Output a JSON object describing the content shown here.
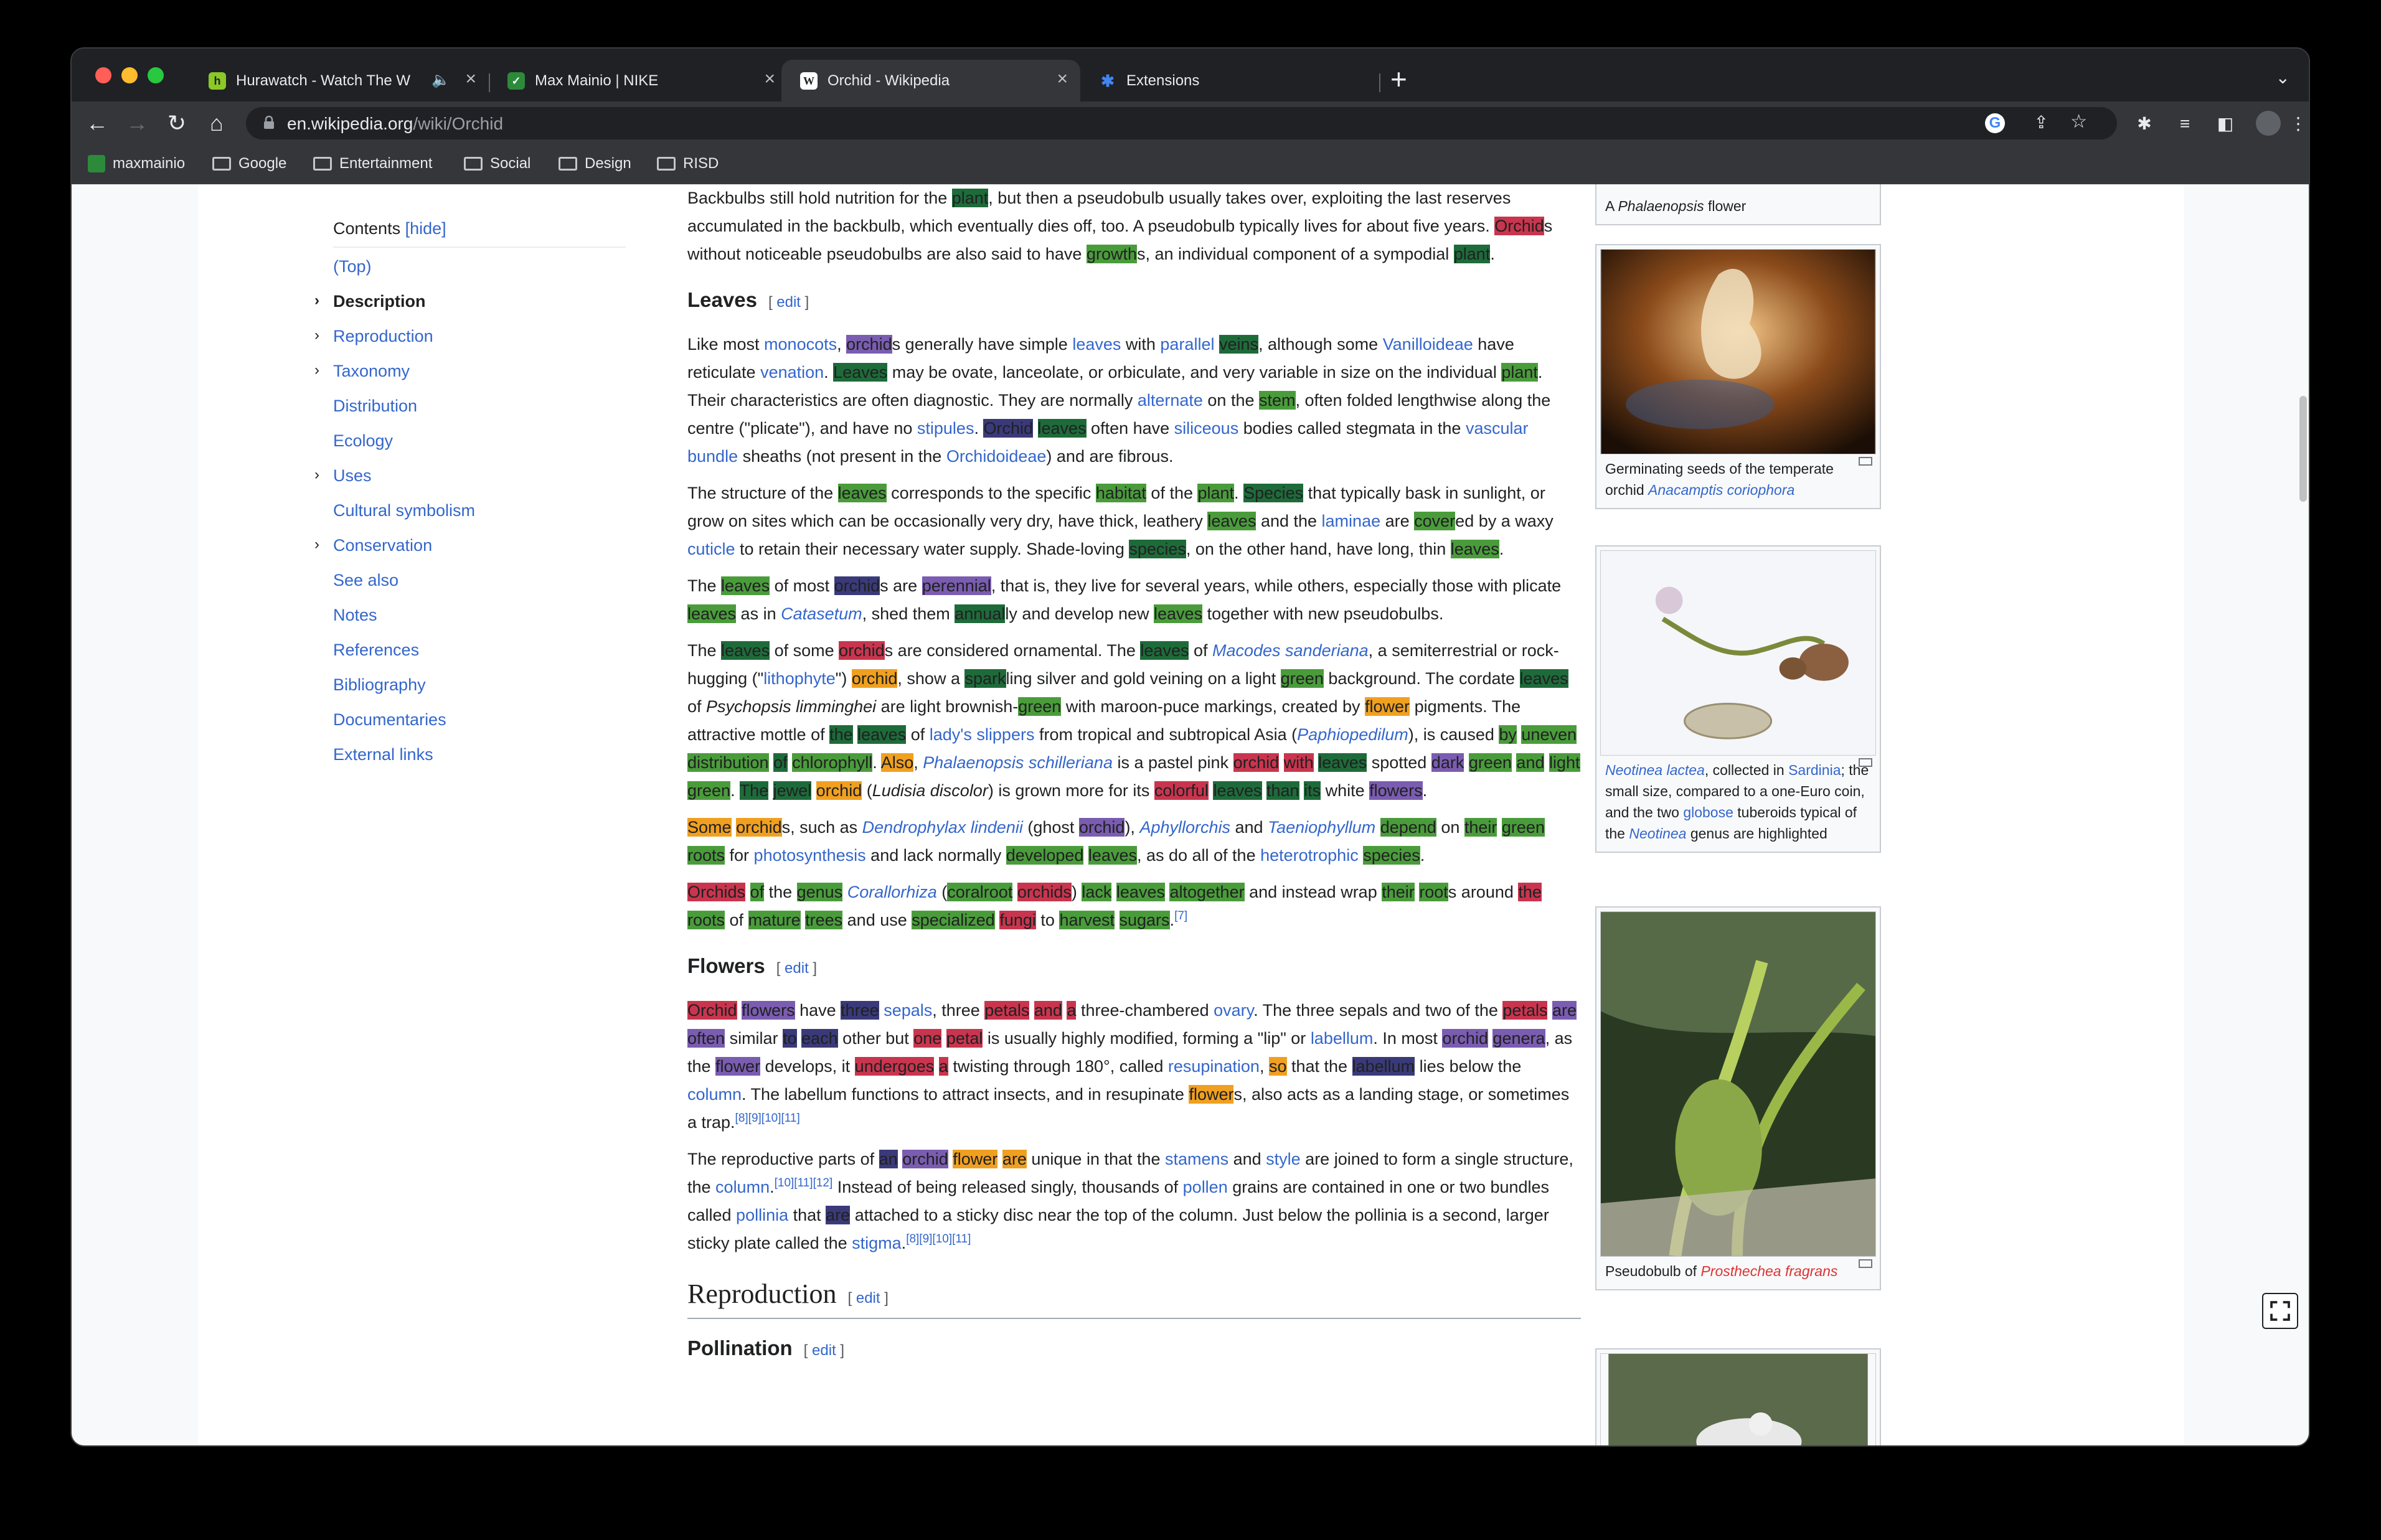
{
  "browser": {
    "tabs": [
      {
        "title": "Hurawatch - Watch The W",
        "icon": "hurawatch-icon",
        "audio": true
      },
      {
        "title": "Max Mainio | NIKE",
        "icon": "nike-icon"
      },
      {
        "title": "Orchid - Wikipedia",
        "icon": "wikipedia-icon",
        "active": true
      },
      {
        "title": "Extensions",
        "icon": "puzzle-icon"
      }
    ],
    "url_domain": "en.wikipedia.org",
    "url_path": "/wiki/Orchid",
    "bookmarks": [
      "maxmainio",
      "Google",
      "Entertainment",
      "Social",
      "Design",
      "RISD"
    ]
  },
  "toc": {
    "title": "Contents",
    "hide": "[hide]",
    "items": [
      "(Top)",
      "Description",
      "Reproduction",
      "Taxonomy",
      "Distribution",
      "Ecology",
      "Uses",
      "Cultural symbolism",
      "Conservation",
      "See also",
      "Notes",
      "References",
      "Bibliography",
      "Documentaries",
      "External links"
    ]
  },
  "article": {
    "leaves_heading": "Leaves",
    "flowers_heading": "Flowers",
    "reproduction_heading": "Reproduction",
    "pollination_heading": "Pollination",
    "edit": "edit"
  },
  "thumbs": {
    "t1": "A Phalaenopsis flower",
    "t2": "Germinating seeds of the temperate orchid Anacamptis coriophora",
    "t3": "Neotinea lactea, collected in Sardinia; the small size, compared to a one-Euro coin, and the two globose tuberoids typical of the Neotinea genus are highlighted",
    "t4": "Pseudobulb of Prosthechea fragrans"
  },
  "colors": {
    "link": "#3366cc",
    "highlight_green": "#4a9c3b",
    "highlight_dark_green": "#1e6b3a",
    "highlight_purple": "#7a5cb0",
    "highlight_red": "#c9354e",
    "highlight_orange": "#f0a020"
  }
}
